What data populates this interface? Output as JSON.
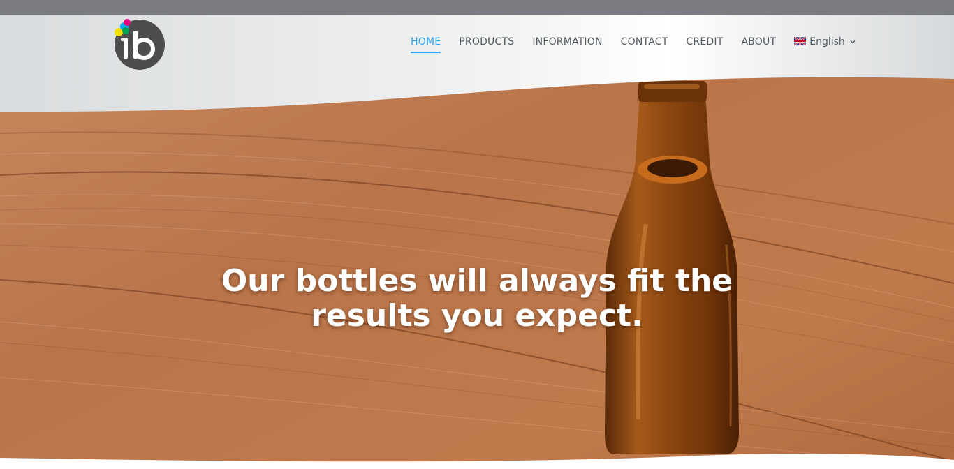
{
  "brand": {
    "logo_text": "ib",
    "logo_icon": "colored-dots-ib-logo"
  },
  "nav": {
    "items": [
      {
        "label": "HOME",
        "active": true
      },
      {
        "label": "PRODUCTS",
        "active": false
      },
      {
        "label": "INFORMATION",
        "active": false
      },
      {
        "label": "CONTACT",
        "active": false
      },
      {
        "label": "CREDIT",
        "active": false
      },
      {
        "label": "ABOUT",
        "active": false
      }
    ],
    "language": {
      "label": "English",
      "flag_icon": "uk-flag-icon",
      "dropdown_icon": "chevron-down-icon"
    }
  },
  "hero": {
    "headline": "Our bottles will always fit the results you expect.",
    "image": "brown-glass-bottle-on-wooden-table"
  },
  "colors": {
    "accent": "#2ea3f2",
    "nav_text": "#555a60",
    "top_bar": "#7a7b80",
    "header_bg": "#e4e6e7",
    "wood": "#b87045",
    "bottle": "#8a4510"
  }
}
